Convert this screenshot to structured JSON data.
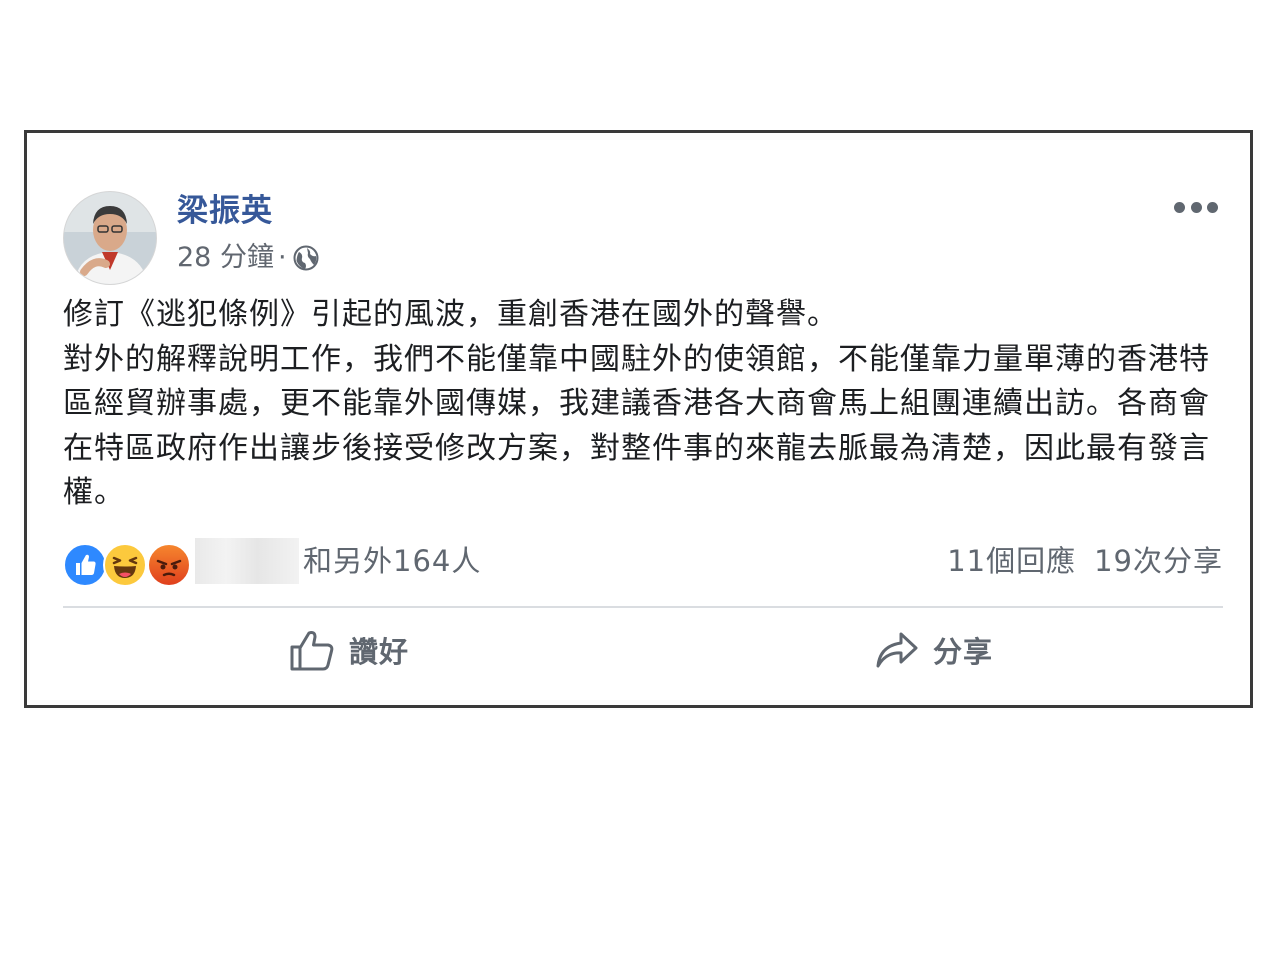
{
  "post": {
    "author": "梁振英",
    "time": "28 分鐘",
    "separator": "·",
    "privacy_icon": "globe-icon",
    "paragraphs": [
      "修訂《逃犯條例》引起的風波，重創香港在國外的聲譽。",
      "對外的解釋說明工作，我們不能僅靠中國駐外的使領館，不能僅靠力量單薄的香港特區經貿辦事處，更不能靠外國傳媒，我建議香港各大商會馬上組團連續出訪。各商會在特區政府作出讓步後接受修改方案，對整件事的來龍去脈最為清楚，因此最有發言權。"
    ]
  },
  "reactions": {
    "types": [
      "like-reaction-icon",
      "haha-reaction-icon",
      "angry-reaction-icon"
    ],
    "summary": "和另外164人",
    "comments": "11個回應",
    "shares": "19次分享"
  },
  "actions": {
    "like_label": "讚好",
    "share_label": "分享"
  },
  "colors": {
    "author_name": "#365899",
    "secondary_text": "#606770",
    "like_blue": "#2e89ff",
    "card_border": "#3a3a3a"
  }
}
